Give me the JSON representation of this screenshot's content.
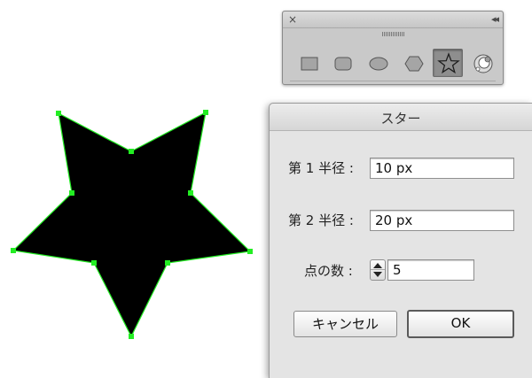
{
  "toolbox": {
    "close_glyph": "×",
    "collapse_glyph": "◂◂",
    "tools": [
      {
        "name": "rectangle-icon",
        "selected": false
      },
      {
        "name": "rounded-rectangle-icon",
        "selected": false
      },
      {
        "name": "ellipse-icon",
        "selected": false
      },
      {
        "name": "polygon-icon",
        "selected": false
      },
      {
        "name": "star-icon",
        "selected": true
      },
      {
        "name": "flare-icon",
        "selected": false
      }
    ]
  },
  "dialog": {
    "title": "スター",
    "radius1_label": "第 1 半径 :",
    "radius1_value": "10 px",
    "radius2_label": "第 2 半径 :",
    "radius2_value": "20 px",
    "points_label": "点の数 :",
    "points_value": "5",
    "cancel_label": "キャンセル",
    "ok_label": "OK"
  },
  "artboard": {
    "shape": "star",
    "points": 5,
    "fill_color": "#000000",
    "selection_color": "#22ee22"
  }
}
